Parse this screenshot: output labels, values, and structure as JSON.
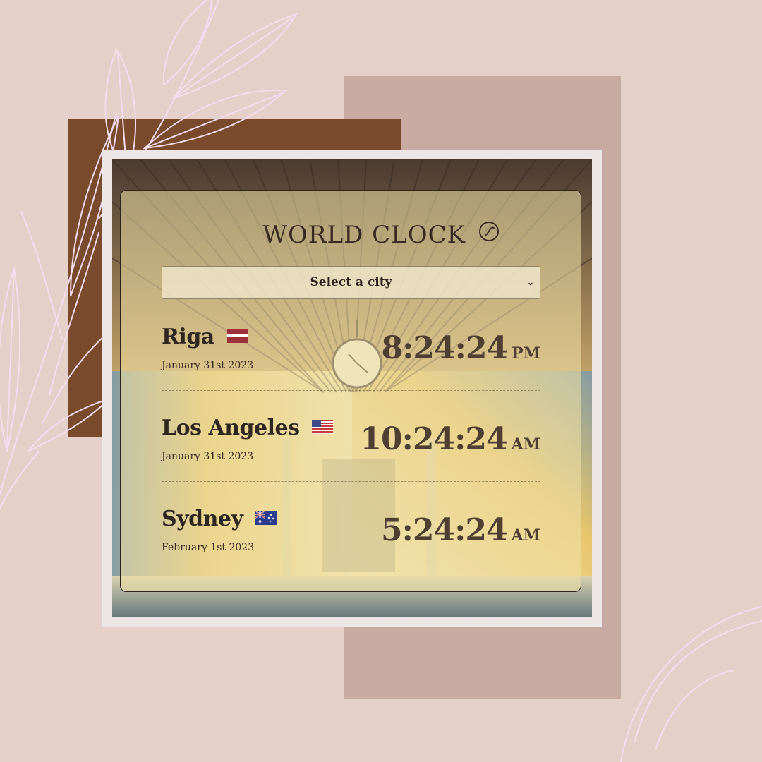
{
  "colors": {
    "background": "#e6d1ca",
    "brown_block": "#7a4a2c",
    "mauve_block": "#c8aca3",
    "text_dark": "#2f2620",
    "time_text": "#4f3f33"
  },
  "app": {
    "title": "WORLD CLOCK",
    "title_icon": "clock-icon"
  },
  "select": {
    "selected": "Select a city",
    "chevron_icon": "chevron-down-icon"
  },
  "cities": [
    {
      "name": "Riga",
      "flag": "latvia-flag",
      "date": "January 31st 2023",
      "time": "8:24:24",
      "ampm": "PM"
    },
    {
      "name": "Los Angeles",
      "flag": "usa-flag",
      "date": "January 31st 2023",
      "time": "10:24:24",
      "ampm": "AM"
    },
    {
      "name": "Sydney",
      "flag": "australia-flag",
      "date": "February 1st 2023",
      "time": "5:24:24",
      "ampm": "AM"
    }
  ]
}
